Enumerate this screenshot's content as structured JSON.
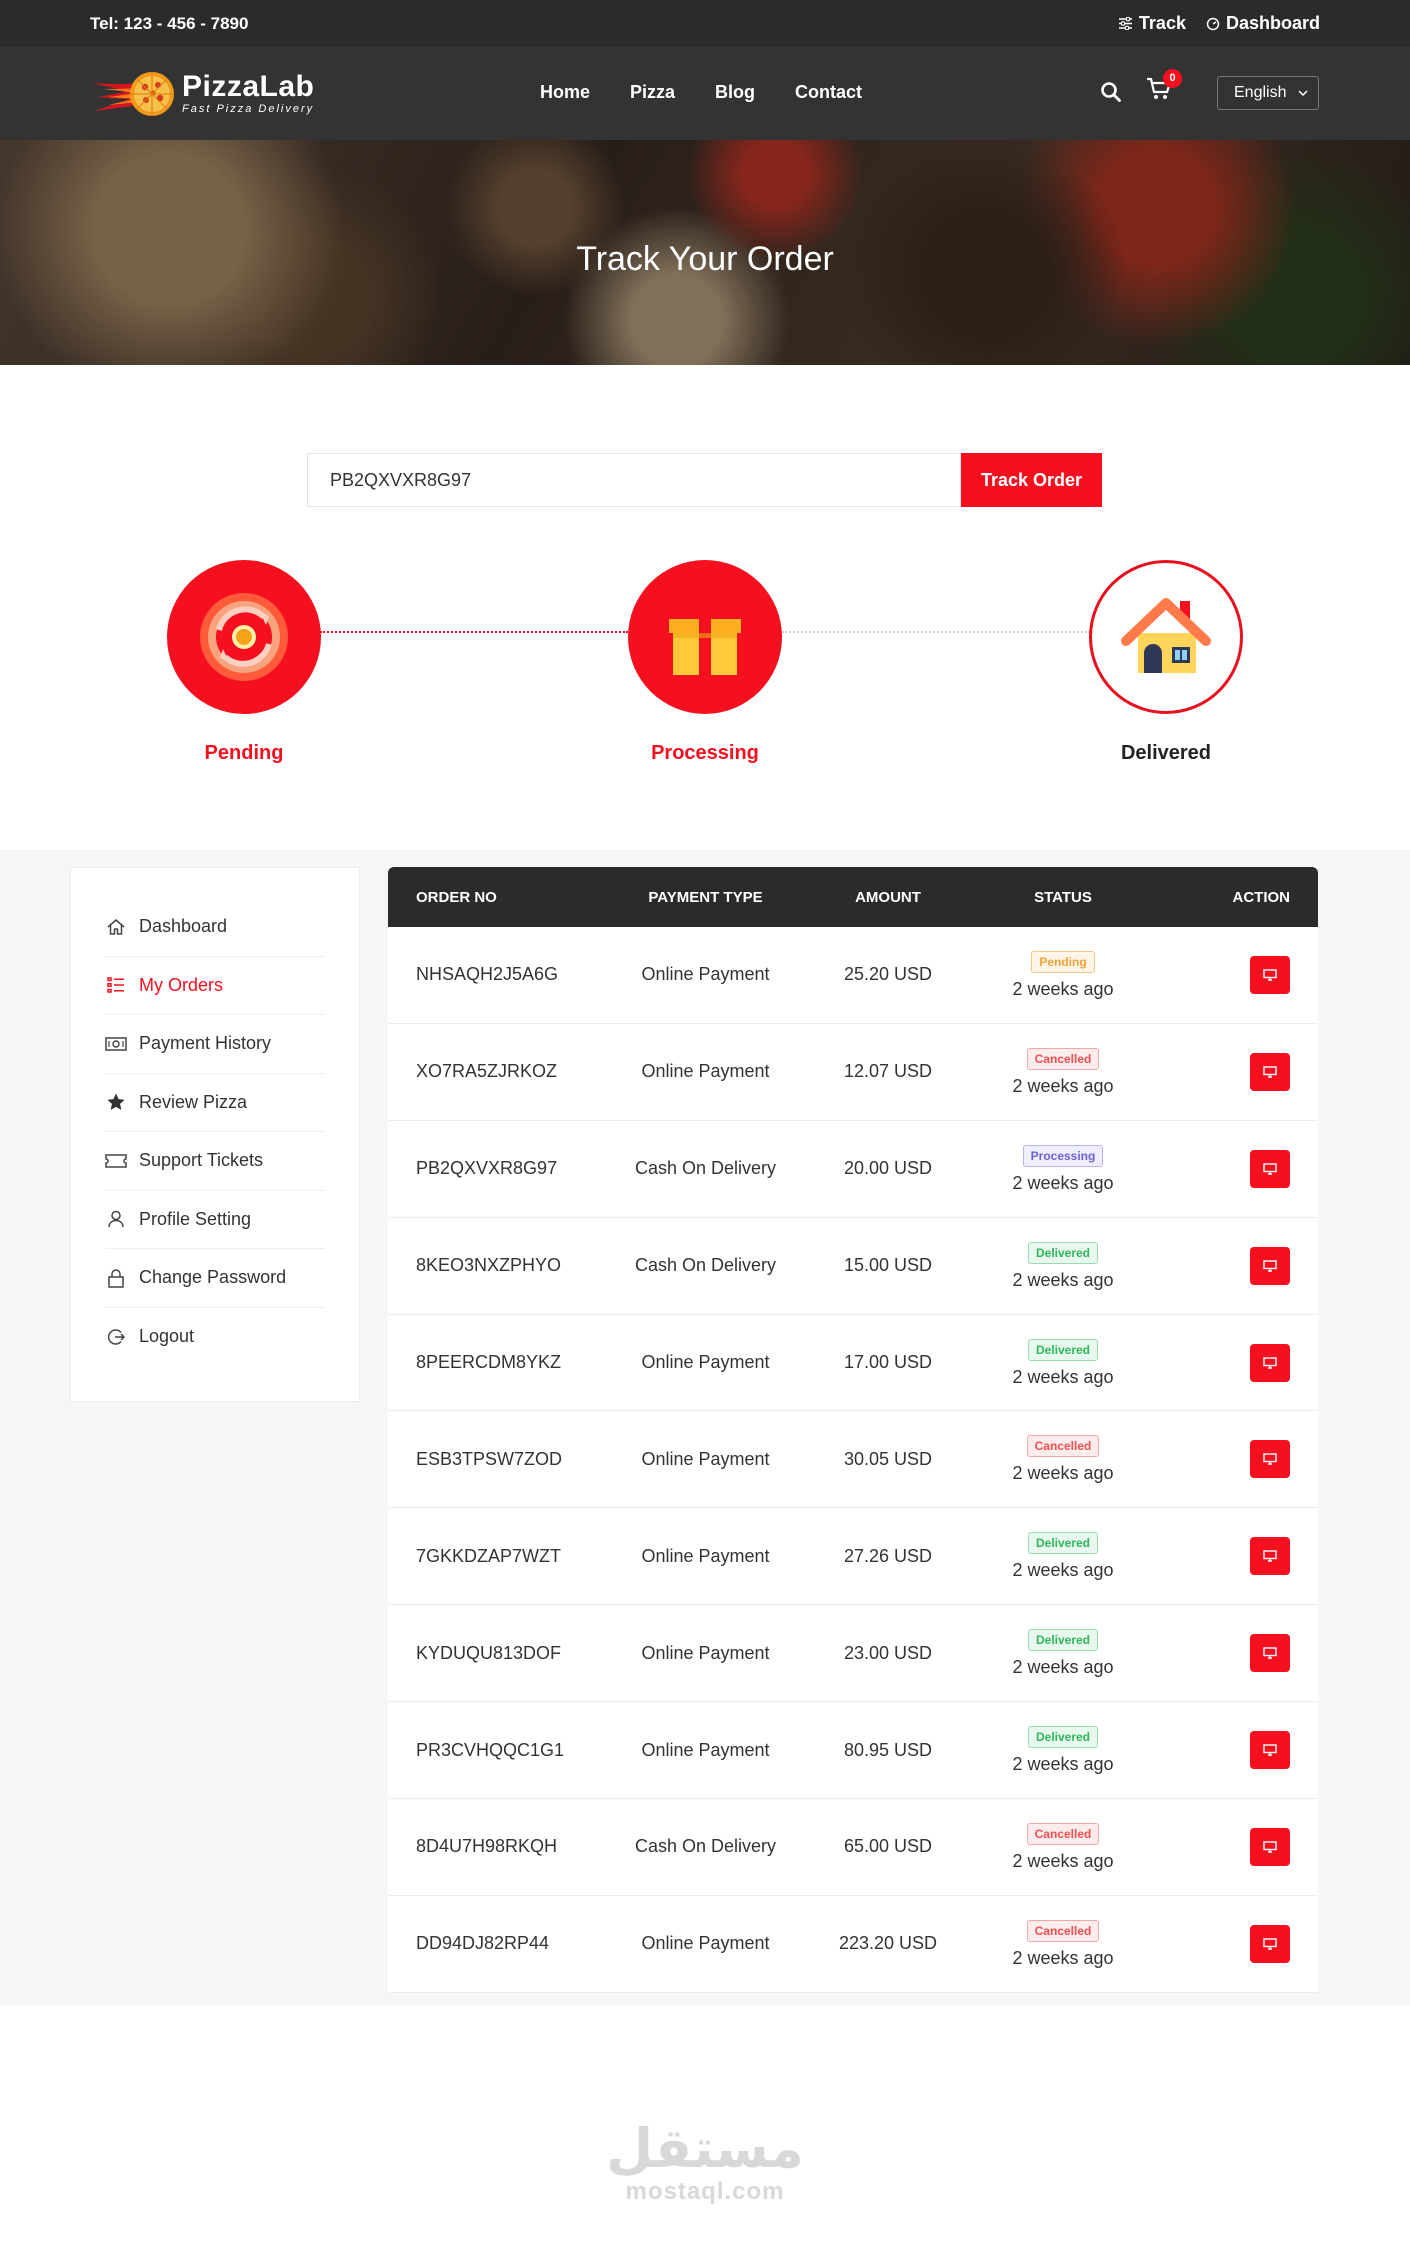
{
  "topbar": {
    "tel": "Tel: 123 - 456 - 7890",
    "track_label": "Track",
    "dashboard_label": "Dashboard"
  },
  "header": {
    "brand": "PizzaLab",
    "tagline": "Fast Pizza Delivery",
    "nav": [
      "Home",
      "Pizza",
      "Blog",
      "Contact"
    ],
    "cart_count": "0",
    "language": "English"
  },
  "hero": {
    "title": "Track Your Order"
  },
  "track": {
    "input_value": "PB2QXVXR8G97",
    "button_label": "Track Order"
  },
  "steps": [
    {
      "label": "Pending"
    },
    {
      "label": "Processing"
    },
    {
      "label": "Delivered"
    }
  ],
  "sidebar": {
    "items": [
      {
        "label": "Dashboard",
        "icon": "home-icon"
      },
      {
        "label": "My Orders",
        "icon": "list-icon"
      },
      {
        "label": "Payment History",
        "icon": "cash-icon"
      },
      {
        "label": "Review Pizza",
        "icon": "star-icon"
      },
      {
        "label": "Support Tickets",
        "icon": "ticket-icon"
      },
      {
        "label": "Profile Setting",
        "icon": "user-icon"
      },
      {
        "label": "Change Password",
        "icon": "lock-icon"
      },
      {
        "label": "Logout",
        "icon": "logout-icon"
      }
    ]
  },
  "orders": {
    "headers": [
      "ORDER NO",
      "PAYMENT TYPE",
      "AMOUNT",
      "STATUS",
      "ACTION"
    ],
    "rows": [
      {
        "order_no": "NHSAQH2J5A6G",
        "payment": "Online Payment",
        "amount": "25.20 USD",
        "status": "Pending",
        "time": "2 weeks ago"
      },
      {
        "order_no": "XO7RA5ZJRKOZ",
        "payment": "Online Payment",
        "amount": "12.07 USD",
        "status": "Cancelled",
        "time": "2 weeks ago"
      },
      {
        "order_no": "PB2QXVXR8G97",
        "payment": "Cash On Delivery",
        "amount": "20.00 USD",
        "status": "Processing",
        "time": "2 weeks ago"
      },
      {
        "order_no": "8KEO3NXZPHYO",
        "payment": "Cash On Delivery",
        "amount": "15.00 USD",
        "status": "Delivered",
        "time": "2 weeks ago"
      },
      {
        "order_no": "8PEERCDM8YKZ",
        "payment": "Online Payment",
        "amount": "17.00 USD",
        "status": "Delivered",
        "time": "2 weeks ago"
      },
      {
        "order_no": "ESB3TPSW7ZOD",
        "payment": "Online Payment",
        "amount": "30.05 USD",
        "status": "Cancelled",
        "time": "2 weeks ago"
      },
      {
        "order_no": "7GKKDZAP7WZT",
        "payment": "Online Payment",
        "amount": "27.26 USD",
        "status": "Delivered",
        "time": "2 weeks ago"
      },
      {
        "order_no": "KYDUQU813DOF",
        "payment": "Online Payment",
        "amount": "23.00 USD",
        "status": "Delivered",
        "time": "2 weeks ago"
      },
      {
        "order_no": "PR3CVHQQC1G1",
        "payment": "Online Payment",
        "amount": "80.95 USD",
        "status": "Delivered",
        "time": "2 weeks ago"
      },
      {
        "order_no": "8D4U7H98RKQH",
        "payment": "Cash On Delivery",
        "amount": "65.00 USD",
        "status": "Cancelled",
        "time": "2 weeks ago"
      },
      {
        "order_no": "DD94DJ82RP44",
        "payment": "Online Payment",
        "amount": "223.20 USD",
        "status": "Cancelled",
        "time": "2 weeks ago"
      }
    ]
  },
  "watermark": {
    "arabic": "مستقل",
    "latin": "mostaql.com"
  },
  "colors": {
    "accent": "#f5101f",
    "dark": "#2b2b2b",
    "header": "#333333"
  }
}
